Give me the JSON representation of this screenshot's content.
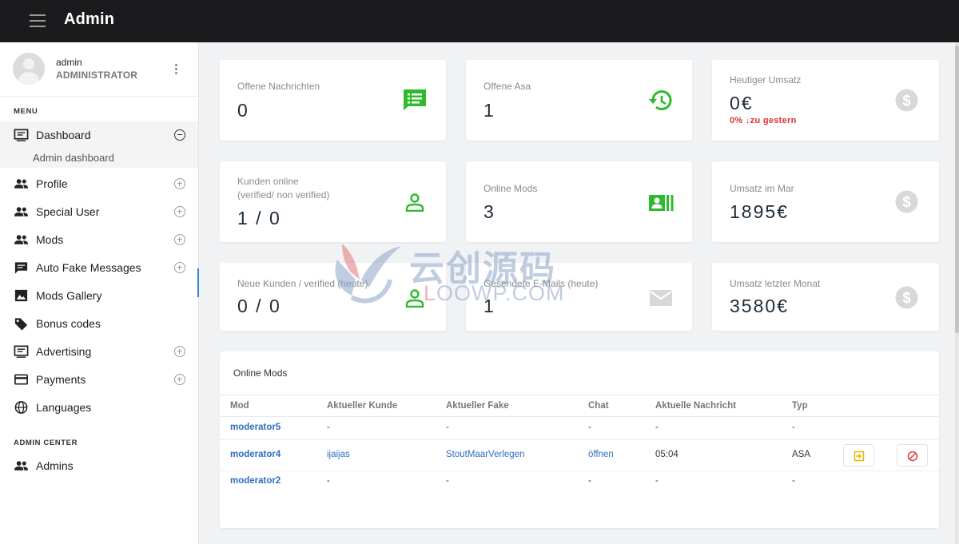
{
  "header": {
    "title": "Admin"
  },
  "user": {
    "name": "admin",
    "role": "ADMINISTRATOR"
  },
  "sidebar": {
    "menu_label": "MENU",
    "admin_center_label": "ADMIN CENTER",
    "items": [
      {
        "label": "Dashboard",
        "icon": "dashboard-icon",
        "toggle": "collapse"
      },
      {
        "label": "Profile",
        "icon": "people-icon",
        "toggle": "expand"
      },
      {
        "label": "Special User",
        "icon": "people-icon",
        "toggle": "expand"
      },
      {
        "label": "Mods",
        "icon": "people-icon",
        "toggle": "expand"
      },
      {
        "label": "Auto Fake Messages",
        "icon": "message-icon",
        "toggle": "expand"
      },
      {
        "label": "Mods Gallery",
        "icon": "image-icon",
        "toggle": "none"
      },
      {
        "label": "Bonus codes",
        "icon": "tag-icon",
        "toggle": "none"
      },
      {
        "label": "Advertising",
        "icon": "dashboard-icon",
        "toggle": "expand"
      },
      {
        "label": "Payments",
        "icon": "credit-card-icon",
        "toggle": "expand"
      },
      {
        "label": "Languages",
        "icon": "globe-icon",
        "toggle": "none"
      }
    ],
    "subitem": "Admin dashboard",
    "admin_items": [
      {
        "label": "Admins",
        "icon": "people-icon"
      }
    ]
  },
  "cards": [
    {
      "label": "Offene Nachrichten",
      "value": "0",
      "icon": "chat-list-icon",
      "color": "#2dbb2d"
    },
    {
      "label": "Offene Asa",
      "value": "1",
      "icon": "history-icon",
      "color": "#2dbb2d"
    },
    {
      "label": "Heutiger Umsatz",
      "value": "0€",
      "sub": "0% ↓zu gestern",
      "icon": "dollar-icon",
      "color": "#d8d8d8"
    },
    {
      "label": "Kunden online",
      "label2": "(verified/ non verified)",
      "value": "1 / 0",
      "icon": "person-icon",
      "color": "#2dbb2d"
    },
    {
      "label": "Online Mods",
      "value": "3",
      "icon": "contact-card-icon",
      "color": "#2dbb2d"
    },
    {
      "label": "Umsatz im Mar",
      "value": "1895€",
      "icon": "dollar-icon",
      "color": "#d8d8d8"
    },
    {
      "label": "Neue Kunden / verified (heute)",
      "value": "0 / 0",
      "icon": "person-icon",
      "color": "#2dbb2d"
    },
    {
      "label": "Gesendete E-Mails (heute)",
      "value": "1",
      "icon": "mail-icon",
      "color": "#d8d8d8"
    },
    {
      "label": "Umsatz letzter Monat",
      "value": "3580€",
      "icon": "dollar-icon",
      "color": "#d8d8d8"
    }
  ],
  "table": {
    "title": "Online Mods",
    "columns": [
      "Mod",
      "Aktueller Kunde",
      "Aktueller Fake",
      "Chat",
      "Aktuelle Nachricht",
      "Typ"
    ],
    "rows": [
      {
        "mod": "moderator5",
        "kunde": "-",
        "fake": "-",
        "chat": "-",
        "nachricht": "-",
        "typ": "-"
      },
      {
        "mod": "moderator4",
        "kunde": "ijaijas",
        "fake": "StoutMaarVerlegen",
        "chat": "öffnen",
        "nachricht": "05:04",
        "typ": "ASA"
      },
      {
        "mod": "moderator2",
        "kunde": "-",
        "fake": "-",
        "chat": "-",
        "nachricht": "-",
        "typ": "-"
      }
    ]
  },
  "watermark": {
    "cn": "云创源码",
    "en_a": "OOWP",
    "en_b": ".COM",
    "en_prefix": "L"
  }
}
